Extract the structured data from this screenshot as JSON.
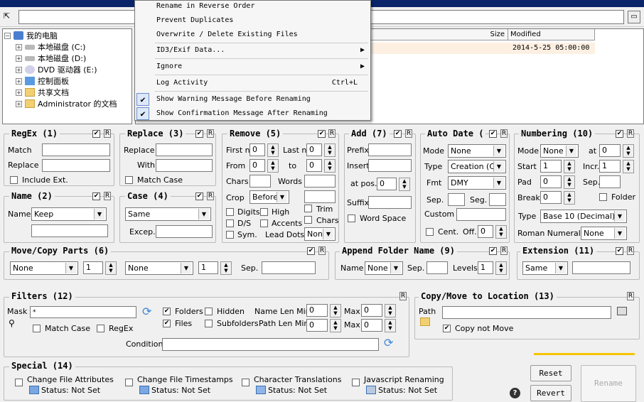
{
  "tree": {
    "items": [
      {
        "label": "我的电脑",
        "expander": "−"
      },
      {
        "label": "本地磁盘 (C:)",
        "expander": "+"
      },
      {
        "label": "本地磁盘 (D:)",
        "expander": "+"
      },
      {
        "label": "DVD 驱动器 (E:)",
        "expander": "+"
      },
      {
        "label": "控制面板",
        "expander": "+"
      },
      {
        "label": "共享文档",
        "expander": "+"
      },
      {
        "label": "Administrator 的文档",
        "expander": "+"
      }
    ]
  },
  "filelist": {
    "col_size": "Size",
    "col_modified": "Modified",
    "row_modified": "2014-5-25 05:00:00"
  },
  "menu": {
    "items": [
      {
        "label": "Rename in Reverse Order"
      },
      {
        "label": "Prevent Duplicates"
      },
      {
        "label": "Overwrite / Delete Existing Files"
      },
      {
        "label": "ID3/Exif Data...",
        "arrow": "▶"
      },
      {
        "label": "Ignore",
        "arrow": "▶"
      },
      {
        "label": "Log Activity",
        "shortcut": "Ctrl+L"
      },
      {
        "label": "Show Warning Message Before Renaming",
        "check": "✔"
      },
      {
        "label": "Show Confirmation Message After Renaming",
        "check": "✔"
      }
    ]
  },
  "regex": {
    "title": "RegEx (1)",
    "match": "Match",
    "replace": "Replace",
    "include_ext": "Include Ext.",
    "r": "R",
    "check": "✔"
  },
  "replace": {
    "title": "Replace (3)",
    "replace": "Replace",
    "with": "With",
    "match_case": "Match Case",
    "r": "R",
    "check": "✔"
  },
  "remove": {
    "title": "Remove (5)",
    "first_n": "First n",
    "first_n_val": "0",
    "last_n": "Last n",
    "last_n_val": "0",
    "from": "From",
    "from_val": "0",
    "to": "to",
    "to_val": "0",
    "chars": "Chars",
    "words": "Words",
    "crop": "Crop",
    "crop_val": "Before",
    "digits": "Digits",
    "high": "High",
    "trim": "Trim",
    "ds": "D/S",
    "accents": "Accents",
    "chars2": "Chars",
    "sym": "Sym.",
    "lead_dots": "Lead Dots",
    "lead_dots_val": "Non",
    "r": "R",
    "check": "✔"
  },
  "add": {
    "title": "Add (7)",
    "prefix": "Prefix",
    "insert": "Insert",
    "at_pos": "at pos.",
    "at_pos_val": "0",
    "suffix": "Suffix",
    "word_space": "Word Space",
    "r": "R",
    "check": "✔"
  },
  "autodate": {
    "title": "Auto Date (",
    "mode": "Mode",
    "mode_val": "None",
    "type": "Type",
    "type_val": "Creation (Cur",
    "fmt": "Fmt",
    "fmt_val": "DMY",
    "sep": "Sep.",
    "seg": "Seg.",
    "custom": "Custom",
    "cent": "Cent.",
    "off": "Off.",
    "off_val": "0",
    "r": "R",
    "check": "✔"
  },
  "numbering": {
    "title": "Numbering (10)",
    "mode": "Mode",
    "mode_val": "None",
    "at": "at",
    "at_val": "0",
    "start": "Start",
    "start_val": "1",
    "incr": "Incr.",
    "incr_val": "1",
    "pad": "Pad",
    "pad_val": "0",
    "sep": "Sep.",
    "break": "Break",
    "break_val": "0",
    "folder": "Folder",
    "type": "Type",
    "type_val": "Base 10 (Decimal)",
    "roman": "Roman Numerals",
    "roman_val": "None",
    "r": "R",
    "check": "✔"
  },
  "name": {
    "title": "Name (2)",
    "name": "Name",
    "name_val": "Keep",
    "r": "R",
    "check": "✔"
  },
  "case": {
    "title": "Case (4)",
    "case_val": "Same",
    "excep": "Excep.",
    "r": "R",
    "check": "✔"
  },
  "movecopy": {
    "title": "Move/Copy Parts (6)",
    "sel1": "None",
    "num1": "1",
    "sel2": "None",
    "num2": "1",
    "sep": "Sep.",
    "r": "R",
    "check": "✔"
  },
  "appendfolder": {
    "title": "Append Folder Name (9)",
    "name": "Name",
    "name_val": "None",
    "sep": "Sep.",
    "levels": "Levels",
    "levels_val": "1",
    "r": "R",
    "check": "✔"
  },
  "extension": {
    "title": "Extension (11)",
    "val": "Same",
    "r": "R",
    "check": "✔"
  },
  "filters": {
    "title": "Filters (12)",
    "mask": "Mask",
    "mask_val": "*",
    "folders": "Folders",
    "hidden": "Hidden",
    "name_len_min": "Name Len Min",
    "name_len_min_val": "0",
    "max": "Max",
    "max_val": "0",
    "files": "Files",
    "subfolders": "Subfolders",
    "path_len_min": "Path Len Min",
    "path_len_min_val": "0",
    "max2": "Max",
    "max2_val": "0",
    "match_case": "Match Case",
    "regex": "RegEx",
    "condition": "Condition",
    "r": "R",
    "check": "✔"
  },
  "copymove": {
    "title": "Copy/Move to Location (13)",
    "path": "Path",
    "copy_not_move": "Copy not Move",
    "r": "R",
    "check": "✔"
  },
  "special": {
    "title": "Special (14)",
    "items": [
      {
        "label": "Change File Attributes",
        "status": "Status: Not Set"
      },
      {
        "label": "Change File Timestamps",
        "status": "Status: Not Set"
      },
      {
        "label": "Character Translations",
        "status": "Status: Not Set"
      },
      {
        "label": "Javascript Renaming",
        "status": "Status: Not Set"
      }
    ]
  },
  "buttons": {
    "reset": "Reset",
    "revert": "Revert",
    "rename": "Rename",
    "help": "?"
  },
  "colors": {
    "accent_bar": "#f5c400",
    "title_bar": "#0a246a",
    "refresh_icon": "#3f86d8"
  }
}
